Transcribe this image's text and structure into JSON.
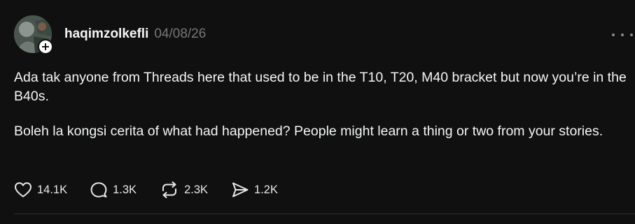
{
  "post": {
    "author": {
      "username": "haqimzolkefli"
    },
    "timestamp": "04/08/26",
    "paragraphs": [
      "Ada tak anyone from Threads here that used to be in the T10, T20, M40 bracket but now you’re in the B40s.",
      "Boleh la kongsi cerita of what had happened? People might learn a thing or two from your stories."
    ],
    "actions": {
      "like": {
        "icon": "heart-icon",
        "count": "14.1K"
      },
      "reply": {
        "icon": "comment-icon",
        "count": "1.3K"
      },
      "repost": {
        "icon": "repost-icon",
        "count": "2.3K"
      },
      "share": {
        "icon": "send-icon",
        "count": "1.2K"
      }
    },
    "colors": {
      "background": "#101010",
      "text": "#f3f5f7",
      "muted": "#777777",
      "divider": "#2d2d2d"
    }
  }
}
